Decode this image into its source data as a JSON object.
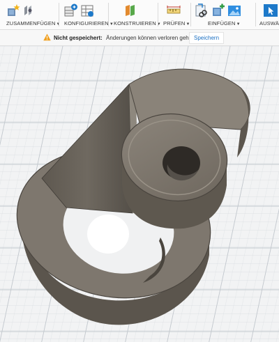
{
  "toolbar": {
    "groups": [
      {
        "label": "ZUSAMMENFÜGEN",
        "icons": [
          "new-component-icon",
          "joint-icon"
        ]
      },
      {
        "label": "KONFIGURIEREN",
        "icons": [
          "configure-icon",
          "configure-table-icon"
        ]
      },
      {
        "label": "KONSTRUIEREN",
        "icons": [
          "construct-plane-icon"
        ]
      },
      {
        "label": "PRÜFEN",
        "icons": [
          "measure-icon"
        ]
      },
      {
        "label": "EINFÜGEN",
        "icons": [
          "insert-link-icon",
          "insert-derive-icon",
          "insert-image-icon"
        ]
      },
      {
        "label": "AUSWÄH",
        "icons": [
          "select-icon"
        ]
      }
    ]
  },
  "notification": {
    "title": "Nicht gespeichert:",
    "message": "Änderungen können verloren gehen",
    "save_label": "Speichern"
  },
  "colors": {
    "accent": "#1a6fc2",
    "model": "#7d766d",
    "grid": "#c9ced4",
    "warning": "#f0a020"
  }
}
